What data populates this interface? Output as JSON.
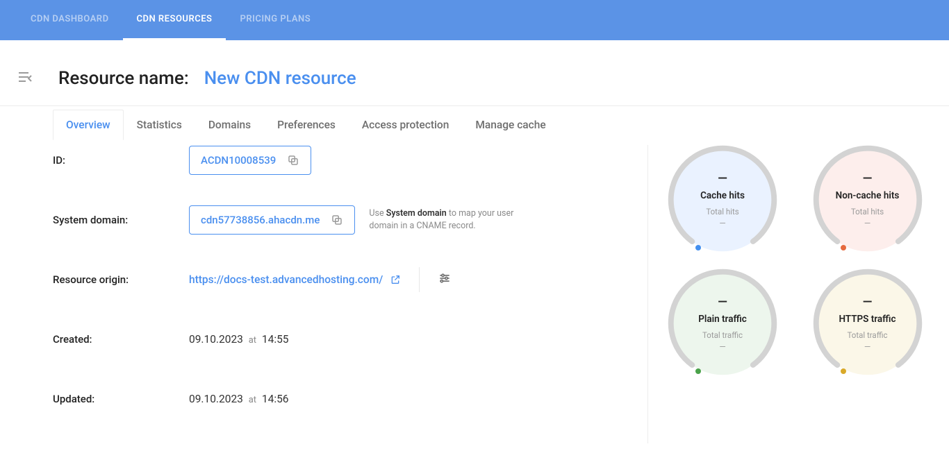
{
  "nav": {
    "items": [
      {
        "label": "CDN DASHBOARD",
        "active": false
      },
      {
        "label": "CDN RESOURCES",
        "active": true
      },
      {
        "label": "PRICING PLANS",
        "active": false
      }
    ]
  },
  "header": {
    "label": "Resource name:",
    "resource_name": "New CDN resource"
  },
  "tabs": [
    {
      "label": "Overview",
      "active": true
    },
    {
      "label": "Statistics",
      "active": false
    },
    {
      "label": "Domains",
      "active": false
    },
    {
      "label": "Preferences",
      "active": false
    },
    {
      "label": "Access protection",
      "active": false
    },
    {
      "label": "Manage cache",
      "active": false
    }
  ],
  "fields": {
    "id_label": "ID:",
    "id_value": "ACDN10008539",
    "system_domain_label": "System domain:",
    "system_domain_value": "cdn57738856.ahacdn.me",
    "system_domain_hint_pre": "Use ",
    "system_domain_hint_strong": "System domain",
    "system_domain_hint_post": " to map your user domain in a CNAME record.",
    "origin_label": "Resource origin:",
    "origin_url": "https://docs-test.advancedhosting.com/",
    "created_label": "Created:",
    "created_date": "09.10.2023",
    "created_at": "at",
    "created_time": "14:55",
    "updated_label": "Updated:",
    "updated_date": "09.10.2023",
    "updated_at": "at",
    "updated_time": "14:56"
  },
  "gauges": [
    {
      "value": "—",
      "title": "Cache hits",
      "sub": "Total hits",
      "sub2": "—",
      "fill": "#eaf2ff",
      "dot": "#428fef"
    },
    {
      "value": "—",
      "title": "Non-cache hits",
      "sub": "Total hits",
      "sub2": "—",
      "fill": "#fdeeec",
      "dot": "#e66a3f"
    },
    {
      "value": "—",
      "title": "Plain traffic",
      "sub": "Total traffic",
      "sub2": "—",
      "fill": "#edf6ed",
      "dot": "#4aa24a"
    },
    {
      "value": "—",
      "title": "HTTPS traffic",
      "sub": "Total traffic",
      "sub2": "—",
      "fill": "#fbf7e8",
      "dot": "#d9a928"
    }
  ]
}
